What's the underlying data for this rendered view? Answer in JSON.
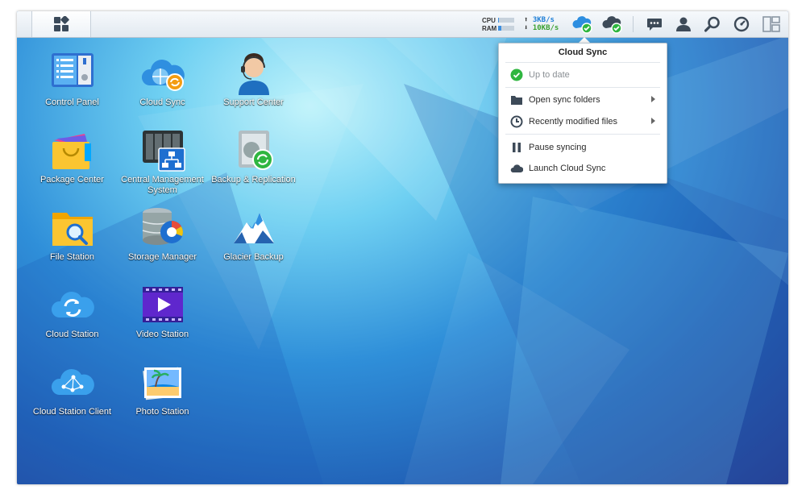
{
  "taskbar": {
    "main_menu_icon": "grid-icon",
    "resource_monitor": {
      "cpu_label": "CPU",
      "ram_label": "RAM",
      "cpu_usage": 0.05,
      "ram_usage": 0.2,
      "upload_speed": "3KB/s",
      "download_speed": "10KB/s"
    },
    "tray_icons": [
      "cloud-sync-tray-icon",
      "cloud-station-tray-icon",
      "notifications-icon",
      "user-icon",
      "search-icon",
      "widgets-icon",
      "pilot-view-icon"
    ]
  },
  "desktop": {
    "icons": [
      {
        "id": "control-panel",
        "label": "Control Panel"
      },
      {
        "id": "cloud-sync",
        "label": "Cloud Sync"
      },
      {
        "id": "support-center",
        "label": "Support Center"
      },
      {
        "id": "package-center",
        "label": "Package Center"
      },
      {
        "id": "central-management-system",
        "label": "Central Management System"
      },
      {
        "id": "backup-replication",
        "label": "Backup & Replication"
      },
      {
        "id": "file-station",
        "label": "File Station"
      },
      {
        "id": "storage-manager",
        "label": "Storage Manager"
      },
      {
        "id": "glacier-backup",
        "label": "Glacier Backup"
      },
      {
        "id": "cloud-station",
        "label": "Cloud Station"
      },
      {
        "id": "video-station",
        "label": "Video Station"
      },
      {
        "id": "cloud-station-client",
        "label": "Cloud Station Client"
      },
      {
        "id": "photo-station",
        "label": "Photo Station"
      }
    ]
  },
  "popup": {
    "title": "Cloud Sync",
    "status": {
      "label": "Up to date",
      "icon": "check-circle-icon",
      "color": "#2fb640"
    },
    "items": [
      {
        "label": "Open sync folders",
        "icon": "folder-icon",
        "submenu": true
      },
      {
        "label": "Recently modified files",
        "icon": "clock-icon",
        "submenu": true
      },
      {
        "label": "Pause syncing",
        "icon": "pause-icon",
        "submenu": false
      },
      {
        "label": "Launch Cloud Sync",
        "icon": "cloud-icon",
        "submenu": false
      }
    ]
  },
  "colors": {
    "accent": "#2f8fd9",
    "success": "#2fb640",
    "upload": "#1f7fd6",
    "download": "#3aa130"
  }
}
